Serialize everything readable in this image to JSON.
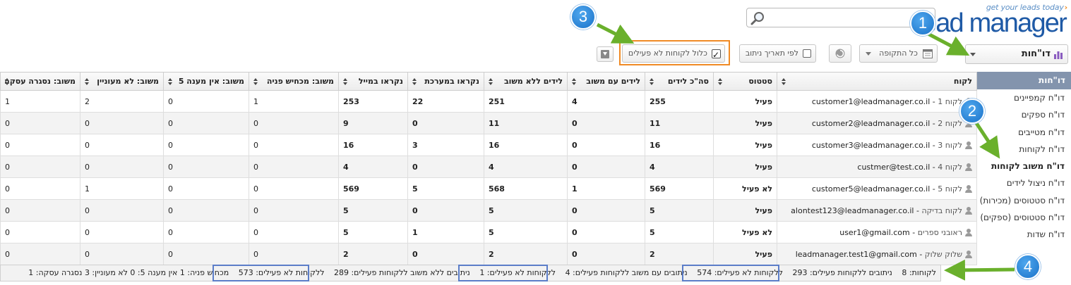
{
  "logo": {
    "tagline": "get your leads today",
    "name": "lead manager"
  },
  "toolbar": {
    "reports_label": "דו\"חות",
    "period_label": "כל התקופה",
    "routing_date_label": "לפי תאריך ניתוב",
    "include_inactive_label": "כלול לקוחות לא פעילים"
  },
  "sidebar": {
    "header": "דו\"חות",
    "items": [
      {
        "label": "דו\"ח קמפיינים"
      },
      {
        "label": "דו\"ח ספקים"
      },
      {
        "label": "דו\"ח מטייבים"
      },
      {
        "label": "דו\"ח לקוחות"
      },
      {
        "label": "דו\"ח משוב לקוחות"
      },
      {
        "label": "דו\"ח ניצול לידים"
      },
      {
        "label": "דו\"ח סטטוסים (מכירות)"
      },
      {
        "label": "דו\"ח סטטוסים (ספקים)"
      },
      {
        "label": "דו\"ח שדות"
      }
    ]
  },
  "table": {
    "headers": [
      "לקוח",
      "סטטוס",
      "סה\"כ לידים",
      "לידים עם משוב",
      "לידים ללא משוב",
      "נקראו במערכת",
      "נקראו במייל",
      "משוב: מכחיש פניה",
      "משוב: אין מענה 5",
      "משוב: לא מעוניין",
      "משוב: נסגרה עסקה"
    ],
    "rows": [
      {
        "name": "לקוח 1",
        "email": "customer1@leadmanager.co.il",
        "status": "פעיל",
        "total": "255",
        "with_fb": "4",
        "without_fb": "251",
        "read_sys": "22",
        "read_mail": "253",
        "denied": "1",
        "no_answer": "0",
        "not_interested": "2",
        "closed": "1"
      },
      {
        "name": "לקוח 2",
        "email": "customer2@leadmanager.co.il",
        "status": "פעיל",
        "total": "11",
        "with_fb": "0",
        "without_fb": "11",
        "read_sys": "0",
        "read_mail": "9",
        "denied": "0",
        "no_answer": "0",
        "not_interested": "0",
        "closed": "0"
      },
      {
        "name": "לקוח 3",
        "email": "customer3@leadmanager.co.il",
        "status": "פעיל",
        "total": "16",
        "with_fb": "0",
        "without_fb": "16",
        "read_sys": "3",
        "read_mail": "16",
        "denied": "0",
        "no_answer": "0",
        "not_interested": "0",
        "closed": "0"
      },
      {
        "name": "לקוח 4",
        "email": "custmer@test.co.il",
        "status": "פעיל",
        "total": "4",
        "with_fb": "0",
        "without_fb": "4",
        "read_sys": "0",
        "read_mail": "4",
        "denied": "0",
        "no_answer": "0",
        "not_interested": "0",
        "closed": "0"
      },
      {
        "name": "לקוח 5",
        "email": "customer5@leadmanager.co.il",
        "status": "לא פעיל",
        "total": "569",
        "with_fb": "1",
        "without_fb": "568",
        "read_sys": "5",
        "read_mail": "569",
        "denied": "0",
        "no_answer": "0",
        "not_interested": "1",
        "closed": "0"
      },
      {
        "name": "לקוח בדיקה",
        "email": "alontest123@leadmanager.co.il",
        "status": "פעיל",
        "total": "5",
        "with_fb": "0",
        "without_fb": "5",
        "read_sys": "0",
        "read_mail": "5",
        "denied": "0",
        "no_answer": "0",
        "not_interested": "0",
        "closed": "0"
      },
      {
        "name": "ראובני ספרים",
        "email": "user1@gmail.com",
        "status": "לא פעיל",
        "total": "5",
        "with_fb": "0",
        "without_fb": "5",
        "read_sys": "1",
        "read_mail": "5",
        "denied": "0",
        "no_answer": "0",
        "not_interested": "0",
        "closed": "0"
      },
      {
        "name": "שלוק שלוק",
        "email": "leadmanager.test1@gmail.com",
        "status": "פעיל",
        "total": "2",
        "with_fb": "0",
        "without_fb": "2",
        "read_sys": "0",
        "read_mail": "2",
        "denied": "0",
        "no_answer": "0",
        "not_interested": "0",
        "closed": "0"
      }
    ]
  },
  "summary": {
    "customers": "לקוחות: 8",
    "routed_active": "ניתובים ללקוחות פעילים: 293",
    "routed_inactive": "ללקוחות לא פעילים: 574",
    "fb_active": "ניתובים עם משוב ללקוחות פעילים: 4",
    "fb_inactive": "ללקוחות לא פעילים: 1",
    "nofb_active": "ניתובים ללא משוב ללקוחות פעילים: 289",
    "nofb_inactive": "ללקוחות לא פעילים: 573",
    "outcomes": "מכחיש פניה: 1 אין מענה 5: 0 לא מעוניין: 3 נסגרה עסקה: 1"
  },
  "callouts": [
    "1",
    "2",
    "3",
    "4"
  ],
  "colors": {
    "callout_blue": "#1a72c9",
    "arrow_green": "#6ab02c",
    "highlight_orange": "#f08a24",
    "highlight_blue": "#5b7dc8",
    "sidebar_header": "#8394ad"
  }
}
